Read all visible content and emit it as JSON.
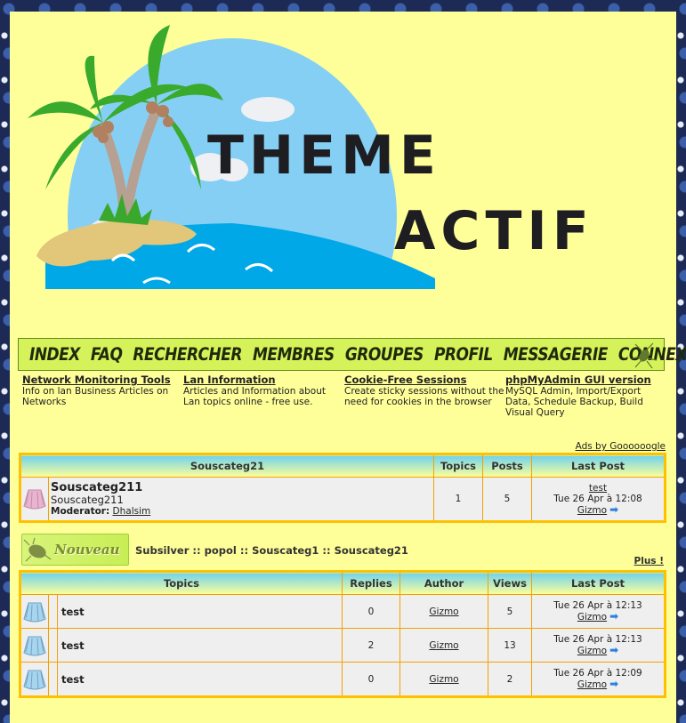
{
  "banner": {
    "title_line1": "THEME",
    "title_line2": "ACTIF"
  },
  "nav": {
    "items": [
      "INDEX",
      "FAQ",
      "RECHERCHER",
      "MEMBRES",
      "GROUPES",
      "PROFIL",
      "MESSAGERIE",
      "CONNEXION"
    ]
  },
  "ads": {
    "items": [
      {
        "title": "Network Monitoring Tools",
        "desc": "Info on lan Business Articles on Networks"
      },
      {
        "title": "Lan Information",
        "desc": "Articles and Information about Lan topics online - free use."
      },
      {
        "title": "Cookie-Free Sessions",
        "desc": "Create sticky sessions without the need for cookies in the browser"
      },
      {
        "title": "phpMyAdmin GUI version",
        "desc": "MySQL Admin, Import/Export Data, Schedule Backup, Build Visual Query"
      }
    ],
    "ads_by": "Ads by Goooooogle"
  },
  "forum_table": {
    "headers": {
      "forum": "Souscateg21",
      "topics": "Topics",
      "posts": "Posts",
      "last_post": "Last Post"
    },
    "rows": [
      {
        "name": "Souscateg211",
        "description": "Souscateg211",
        "moderator_label": "Moderator:",
        "moderator": "Dhalsim",
        "topics": "1",
        "posts": "5",
        "last_post_topic": "test",
        "last_post_date": "Tue 26 Apr à 12:08",
        "last_post_author": "Gizmo"
      }
    ]
  },
  "new_topic_button": "Nouveau",
  "breadcrumb": [
    "Subsilver",
    "popol",
    "Souscateg1",
    "Souscateg21"
  ],
  "breadcrumb_separator": " :: ",
  "more_link": "Plus !",
  "topics_table": {
    "headers": {
      "topics": "Topics",
      "replies": "Replies",
      "author": "Author",
      "views": "Views",
      "last_post": "Last Post"
    },
    "rows": [
      {
        "title": "test",
        "replies": "0",
        "author": "Gizmo",
        "views": "5",
        "last_post_date": "Tue 26 Apr à 12:13",
        "last_post_author": "Gizmo"
      },
      {
        "title": "test",
        "replies": "2",
        "author": "Gizmo",
        "views": "13",
        "last_post_date": "Tue 26 Apr à 12:13",
        "last_post_author": "Gizmo"
      },
      {
        "title": "test",
        "replies": "0",
        "author": "Gizmo",
        "views": "2",
        "last_post_date": "Tue 26 Apr à 12:09",
        "last_post_author": "Gizmo"
      }
    ]
  },
  "colors": {
    "page_bg": "#ffff99",
    "nav_bg": "#d6f25a",
    "table_border": "#ffc000",
    "cell_border": "#f4a000",
    "header_gradient_top": "#6fd3ee",
    "row_bg": "#efefef"
  }
}
